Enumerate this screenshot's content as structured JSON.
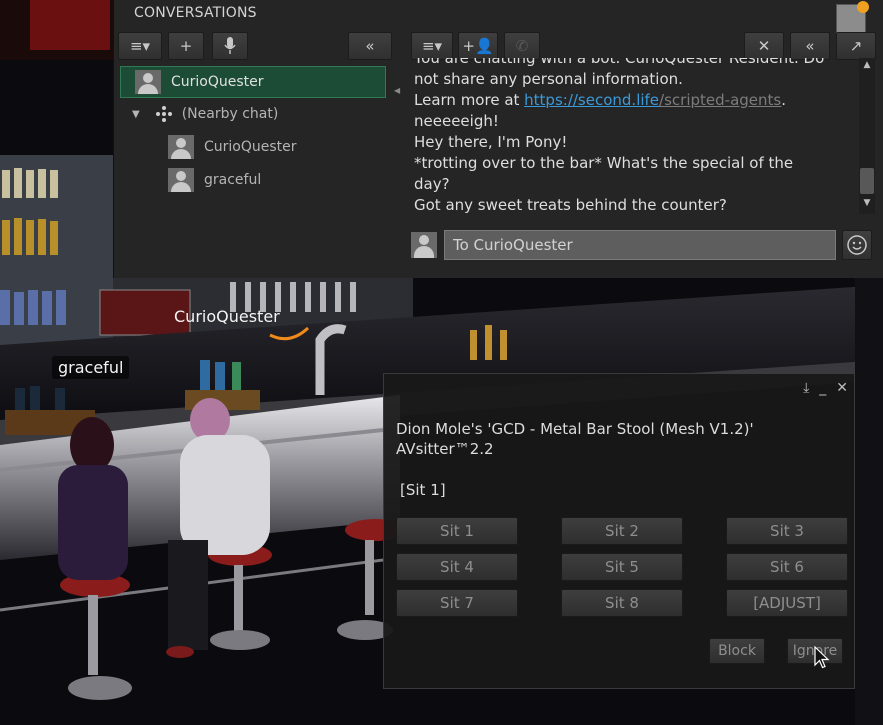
{
  "conversations": {
    "title": "CONVERSATIONS",
    "list": [
      {
        "name": "CurioQuester",
        "selected": true
      },
      {
        "name": "(Nearby chat)",
        "group": true
      },
      {
        "name": "CurioQuester"
      },
      {
        "name": "graceful"
      }
    ],
    "chat_log": [
      {
        "text": "You are chatting with a bot. CurioQuester Resident. Do"
      },
      {
        "text": "not share any personal information."
      },
      {
        "prefix": "Learn more at ",
        "link_main": "https://second.life",
        "link_rest": "/scripted-agents",
        "suffix": "."
      },
      {
        "text": "neeeeeigh!"
      },
      {
        "text": "Hey there, I'm Pony!"
      },
      {
        "text": "*trotting over to the bar* What's the special of the"
      },
      {
        "text": "day?"
      },
      {
        "text": "Got any sweet treats behind the counter?"
      }
    ],
    "input_placeholder": "To CurioQuester"
  },
  "scene_tags": {
    "curio": "CurioQuester",
    "graceful": "graceful"
  },
  "dialog": {
    "title": "Dion Mole's 'GCD - Metal Bar Stool (Mesh V1.2)' AVsitter™2.2",
    "message": "[Sit 1]",
    "buttons": [
      "Sit 1",
      "Sit 2",
      "Sit 3",
      "Sit 4",
      "Sit 5",
      "Sit 6",
      "Sit 7",
      "Sit 8",
      "[ADJUST]"
    ],
    "block": "Block",
    "ignore": "Ignore"
  },
  "colors": {
    "selected_row": "#1c4c35",
    "link": "#3a9ad9"
  }
}
